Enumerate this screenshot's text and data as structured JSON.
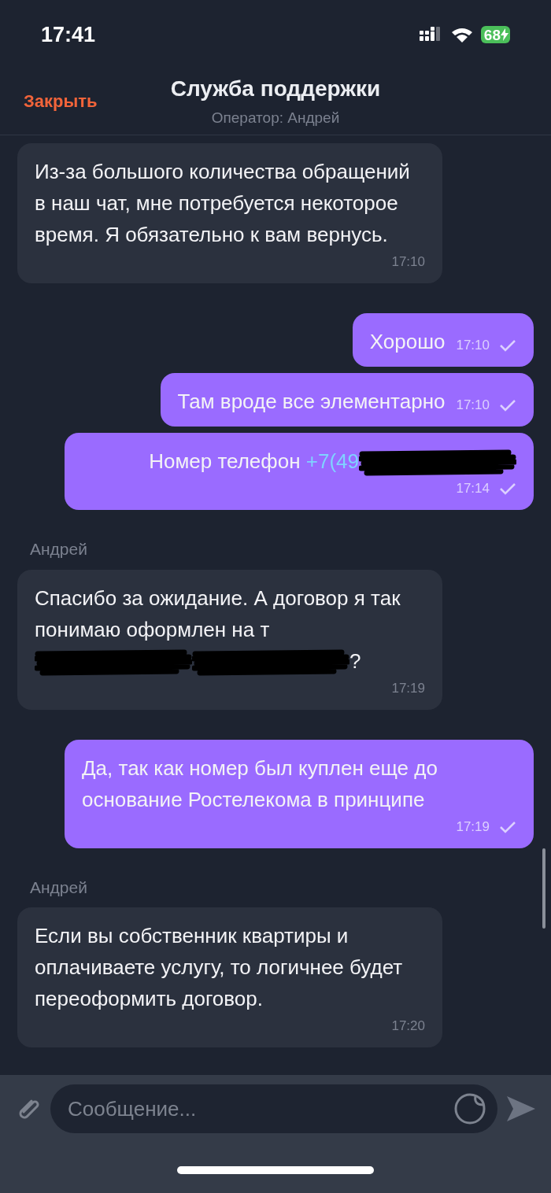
{
  "status_bar": {
    "time": "17:41",
    "battery": "68"
  },
  "header": {
    "close": "Закрыть",
    "title": "Служба поддержки",
    "subtitle": "Оператор: Андрей"
  },
  "messages": [
    {
      "kind": "incoming",
      "parts": [
        {
          "kind": "text",
          "text": "Из-за большого количества обращений в наш чат, мне потребуется некоторое время. Я обязательно к вам вернусь."
        }
      ],
      "time": "17:10"
    },
    {
      "kind": "outgoing",
      "parts": [
        {
          "kind": "text",
          "text": "Хорошо"
        }
      ],
      "time": "17:10",
      "read": true
    },
    {
      "kind": "outgoing",
      "parts": [
        {
          "kind": "text",
          "text": "Там вроде все элементарно"
        }
      ],
      "time": "17:10",
      "read": true
    },
    {
      "kind": "outgoing",
      "parts": [
        {
          "kind": "text",
          "text": "Номер телефон "
        },
        {
          "kind": "link",
          "text": "+7(49"
        },
        {
          "kind": "redaction"
        }
      ],
      "time": "17:14",
      "read": true
    },
    {
      "kind": "incoming",
      "sender": "Андрей",
      "parts": [
        {
          "kind": "text",
          "text": "Спасибо за ожидание. А договор я так понимаю оформлен на т"
        },
        {
          "kind": "redaction"
        },
        {
          "kind": "redaction"
        },
        {
          "kind": "text",
          "text": "?"
        }
      ],
      "time": "17:19"
    },
    {
      "kind": "outgoing",
      "parts": [
        {
          "kind": "text",
          "text": "Да, так как номер был куплен еще до основание Ростелекома в принципе"
        }
      ],
      "time": "17:19",
      "read": true
    },
    {
      "kind": "incoming",
      "sender": "Андрей",
      "parts": [
        {
          "kind": "text",
          "text": "Если вы собственник квартиры и оплачиваете услугу, то логичнее будет переоформить договор."
        }
      ],
      "time": "17:20"
    }
  ],
  "composer": {
    "placeholder": "Сообщение..."
  }
}
